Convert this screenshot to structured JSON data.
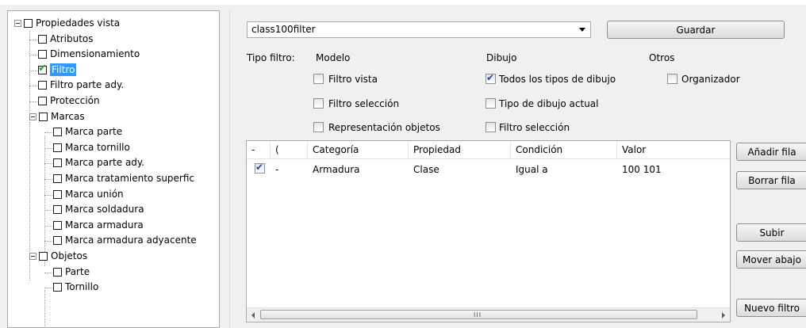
{
  "tree": {
    "nodes": [
      {
        "label": "Propiedades vista",
        "level": 0,
        "expander": true,
        "checked": false,
        "selected": false
      },
      {
        "label": "Atributos",
        "level": 1,
        "expander": false,
        "checked": false,
        "selected": false
      },
      {
        "label": "Dimensionamiento",
        "level": 1,
        "expander": false,
        "checked": false,
        "selected": false
      },
      {
        "label": "Filtro",
        "level": 1,
        "expander": false,
        "checked": true,
        "selected": true
      },
      {
        "label": "Filtro parte ady.",
        "level": 1,
        "expander": false,
        "checked": false,
        "selected": false
      },
      {
        "label": "Protección",
        "level": 1,
        "expander": false,
        "checked": false,
        "selected": false
      },
      {
        "label": "Marcas",
        "level": 1,
        "expander": true,
        "checked": false,
        "selected": false
      },
      {
        "label": "Marca parte",
        "level": 2,
        "expander": false,
        "checked": false,
        "selected": false
      },
      {
        "label": "Marca tornillo",
        "level": 2,
        "expander": false,
        "checked": false,
        "selected": false
      },
      {
        "label": "Marca parte ady.",
        "level": 2,
        "expander": false,
        "checked": false,
        "selected": false
      },
      {
        "label": "Marca tratamiento superfic",
        "level": 2,
        "expander": false,
        "checked": false,
        "selected": false
      },
      {
        "label": "Marca unión",
        "level": 2,
        "expander": false,
        "checked": false,
        "selected": false
      },
      {
        "label": "Marca soldadura",
        "level": 2,
        "expander": false,
        "checked": false,
        "selected": false
      },
      {
        "label": "Marca armadura",
        "level": 2,
        "expander": false,
        "checked": false,
        "selected": false
      },
      {
        "label": "Marca armadura adyacente",
        "level": 2,
        "expander": false,
        "checked": false,
        "selected": false
      },
      {
        "label": "Objetos",
        "level": 1,
        "expander": true,
        "checked": false,
        "selected": false
      },
      {
        "label": "Parte",
        "level": 2,
        "expander": false,
        "checked": false,
        "selected": false
      },
      {
        "label": "Tornillo",
        "level": 2,
        "expander": false,
        "checked": false,
        "selected": false
      }
    ]
  },
  "filter": {
    "selected": "class100filter",
    "save_label": "Guardar"
  },
  "filter_type": {
    "label": "Tipo filtro:",
    "groups": {
      "modelo": {
        "title": "Modelo",
        "options": [
          {
            "label": "Filtro vista",
            "checked": false
          },
          {
            "label": "Filtro selección",
            "checked": false
          },
          {
            "label": "Representación objetos",
            "checked": false
          }
        ]
      },
      "dibujo": {
        "title": "Dibujo",
        "options": [
          {
            "label": "Todos los tipos de dibujo",
            "checked": true
          },
          {
            "label": "Tipo de dibujo actual",
            "checked": false
          },
          {
            "label": "Filtro selección",
            "checked": false
          }
        ]
      },
      "otros": {
        "title": "Otros",
        "options": [
          {
            "label": "Organizador",
            "checked": false
          }
        ]
      }
    }
  },
  "grid": {
    "headers": [
      "-",
      "(",
      "Categoría",
      "Propiedad",
      "Condición",
      "Valor"
    ],
    "rows": [
      {
        "checked": true,
        "col1": "-",
        "col2": "",
        "categoria": "Armadura",
        "propiedad": "Clase",
        "condicion": "Igual a",
        "valor": "100 101"
      }
    ],
    "scroll_grip": "III"
  },
  "buttons": {
    "add_row": "Añadir fila",
    "delete_row": "Borrar fila",
    "move_up": "Subir",
    "move_down": "Mover abajo",
    "new_filter": "Nuevo filtro"
  },
  "colors": {
    "selection": "#3399ff",
    "check_green": "#25a32b",
    "check_blue": "#2a3fb4"
  }
}
